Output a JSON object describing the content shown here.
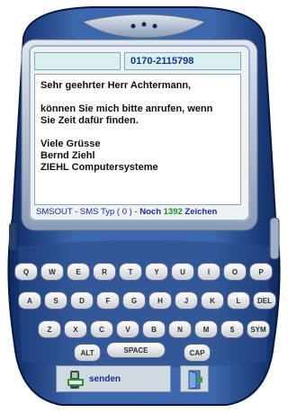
{
  "header": {
    "phone_number": "0170-2115798"
  },
  "message": {
    "lines": [
      "Sehr geehrter Herr Achtermann,",
      "",
      "können Sie mich bitte anrufen, wenn",
      "Sie Zeit dafür finden.",
      "",
      "Viele Grüsse",
      "Bernd Ziehl",
      "ZIEHL Computersysteme"
    ]
  },
  "status": {
    "prefix": "SMSOUT - SMS Typ ( 0 )  -  ",
    "noch": "Noch ",
    "count": "1392",
    "suffix": " Zeichen"
  },
  "keyboard": {
    "row1": [
      "Q",
      "W",
      "E",
      "R",
      "T",
      "Y",
      "U",
      "I",
      "O",
      "P"
    ],
    "row2": [
      "A",
      "S",
      "D",
      "F",
      "G",
      "H",
      "J",
      "K",
      "L",
      "DEL"
    ],
    "row3": [
      "Z",
      "X",
      "C",
      "V",
      "B",
      "N",
      "M",
      "$",
      "SYM"
    ],
    "space_label": "SPACE",
    "cap_label": "CAP",
    "alt_label": "ALT"
  },
  "footer": {
    "send_label": "senden"
  },
  "colors": {
    "body": "#2c4f8f",
    "screen": "#eef2f7",
    "accent": "#1a2f8c",
    "count": "#1a8c1a"
  }
}
